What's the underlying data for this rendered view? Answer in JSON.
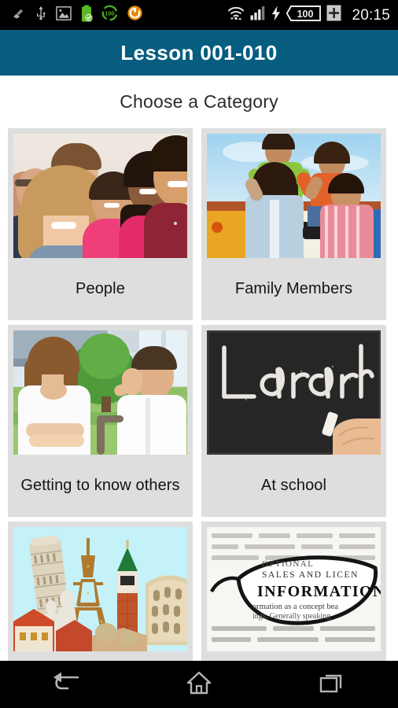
{
  "status_bar": {
    "time": "20:15",
    "battery_text": "100",
    "icons_left": [
      "brush-icon",
      "usb-icon",
      "screenshot-icon",
      "battery-saver-icon",
      "battery-100-icon",
      "sync-icon"
    ],
    "icons_right": [
      "wifi-icon",
      "signal-icon",
      "charging-bolt-icon",
      "battery-level-icon",
      "battery-plus-icon"
    ],
    "background": "#000000"
  },
  "app_bar": {
    "title": "Lesson 001-010",
    "background": "#075d7f",
    "text_color": "#ffffff"
  },
  "page": {
    "heading": "Choose a Category",
    "background": "#ffffff",
    "card_background": "#dedede"
  },
  "categories": [
    {
      "label": "People",
      "image": "group-of-smiling-young-people-photo"
    },
    {
      "label": "Family Members",
      "image": "family-with-children-on-shoulders-photo"
    },
    {
      "label": "Getting to know others",
      "image": "man-and-woman-talking-outdoors-photo"
    },
    {
      "label": "At school",
      "image": "chalkboard-with-word-learn-photo"
    },
    {
      "label": "",
      "image": "european-landmarks-collage-photo"
    },
    {
      "label": "",
      "image": "eyeglasses-over-word-information-photo"
    }
  ],
  "nav_bar": {
    "background": "#000000",
    "buttons": [
      {
        "name": "back",
        "icon": "back-arrow-icon"
      },
      {
        "name": "home",
        "icon": "home-icon"
      },
      {
        "name": "recents",
        "icon": "recent-apps-icon"
      }
    ]
  }
}
